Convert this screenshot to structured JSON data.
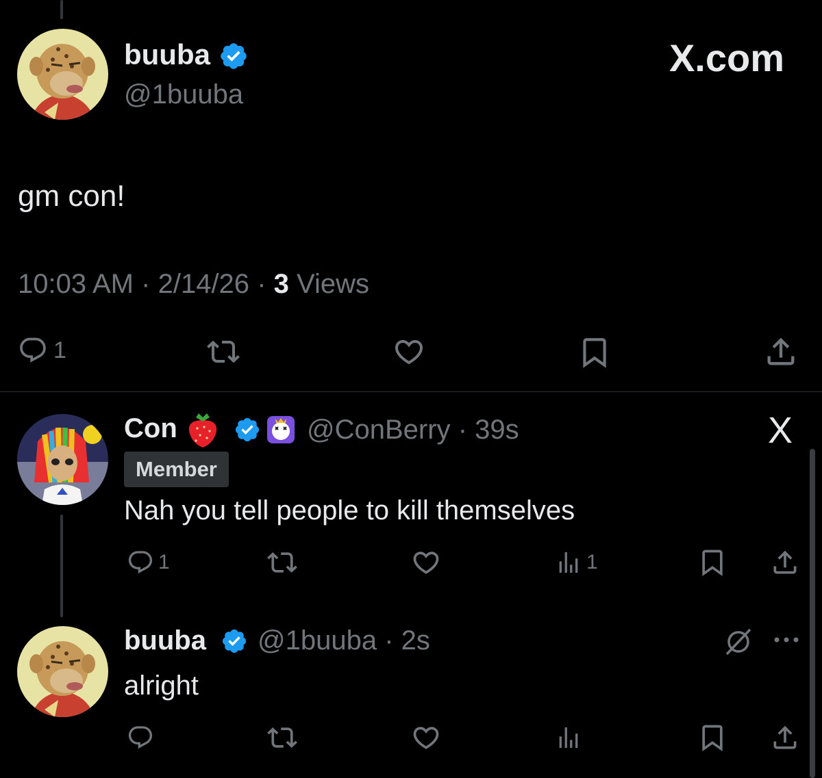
{
  "main_tweet": {
    "display_name": "buuba",
    "handle": "@1buuba",
    "text": "gm con!",
    "time": "10:03 AM",
    "date": "2/14/26",
    "views_count": "3",
    "views_label": "Views",
    "reply_count": "1",
    "site_label": "X.com"
  },
  "reply_1": {
    "display_name": "Con",
    "handle": "@ConBerry",
    "time_ago": "39s",
    "badge": "Member",
    "text": "Nah you tell people to kill themselves",
    "reply_count": "1",
    "views_count": "1",
    "x_mark": "X"
  },
  "reply_2": {
    "display_name": "buuba",
    "handle": "@1buuba",
    "time_ago": "2s",
    "text": "alright"
  },
  "separator": "·",
  "colors": {
    "background": "#000000",
    "text_primary": "#e7e9ea",
    "text_secondary": "#71767b",
    "verified_blue": "#1d9bf0",
    "divider": "#2f3336"
  }
}
